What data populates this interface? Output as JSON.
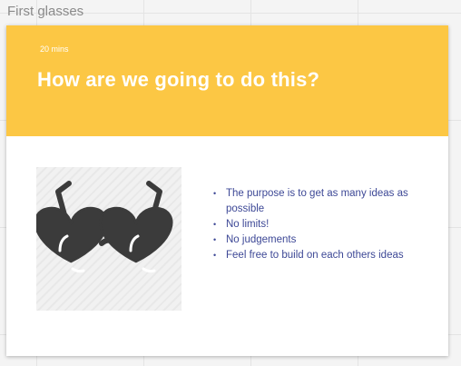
{
  "board": {
    "label": "First glasses"
  },
  "card": {
    "duration": "20 mins",
    "title": "How are we going to do this?",
    "image_icon": "heart-sunglasses-icon",
    "tips": [
      "The purpose is to get as many ideas as possible",
      "No limits!",
      "No judgements",
      "Feel free to build on each others ideas"
    ]
  },
  "colors": {
    "header": "#fcc744",
    "tip_text": "#3d4896",
    "glasses": "#3b3b3b",
    "board_background": "#f4f4f4"
  }
}
